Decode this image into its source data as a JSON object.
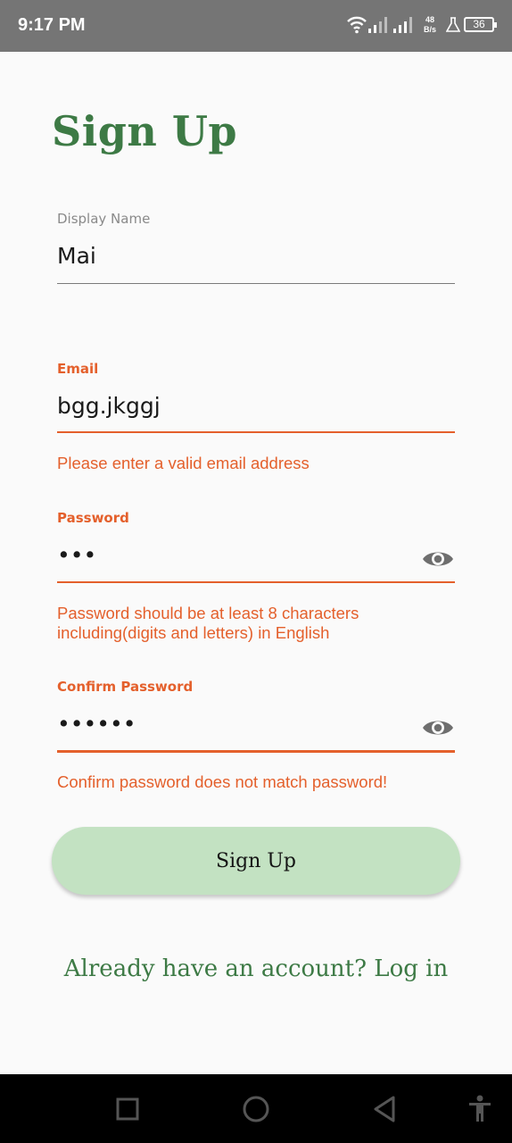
{
  "status_bar": {
    "time": "9:17 PM",
    "net_speed_value": "48",
    "net_speed_unit": "B/s",
    "battery": "36",
    "icons": [
      "wifi-icon",
      "signal-icon",
      "signal-icon",
      "flask-icon",
      "battery-icon"
    ]
  },
  "form": {
    "title": "Sign Up",
    "display_name": {
      "label": "Display Name",
      "value": "Mai"
    },
    "email": {
      "label": "Email",
      "value": "bgg.jkggj",
      "error": "Please enter a valid email address"
    },
    "password": {
      "label": "Password",
      "value": "•••",
      "error_line1": "Password should be at least 8 characters",
      "error_line2": "including(digits and letters) in English"
    },
    "confirm_password": {
      "label": "Confirm Password",
      "value": "••••••",
      "error": "Confirm password does not match password!"
    },
    "submit_label": "Sign Up",
    "login_prompt": "Already have an account? Log in"
  },
  "colors": {
    "accent_green": "#3d7a45",
    "error_orange": "#e4602c",
    "button_bg": "#c3e2c2"
  },
  "nav_bar": {
    "icons": [
      "recents-square-icon",
      "home-circle-icon",
      "back-triangle-icon",
      "accessibility-icon"
    ]
  }
}
